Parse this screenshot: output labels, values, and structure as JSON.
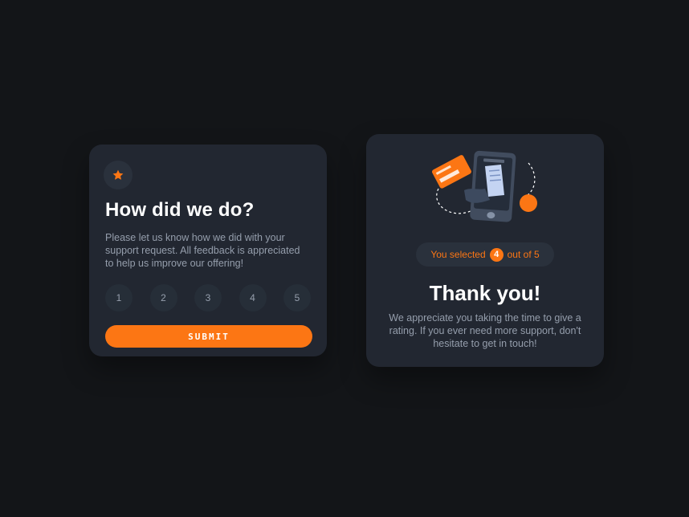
{
  "rating_card": {
    "icon": "star-icon",
    "title": "How did we do?",
    "description": "Please let us know how we did with your support request. All feedback is appreciated to help us improve our offering!",
    "options": [
      "1",
      "2",
      "3",
      "4",
      "5"
    ],
    "submit_label": "SUBMIT"
  },
  "thanks_card": {
    "illustration": "payment-phone-illustration",
    "selected_prefix": "You selected",
    "selected_value": "4",
    "selected_suffix": "out of 5",
    "title": "Thank you!",
    "description": "We appreciate you taking the time to give a rating. If you ever need more support, don't hesitate to get in touch!"
  },
  "colors": {
    "background": "#131518",
    "card": "#222731",
    "accent": "#fc7614",
    "muted_text": "#959eac"
  }
}
